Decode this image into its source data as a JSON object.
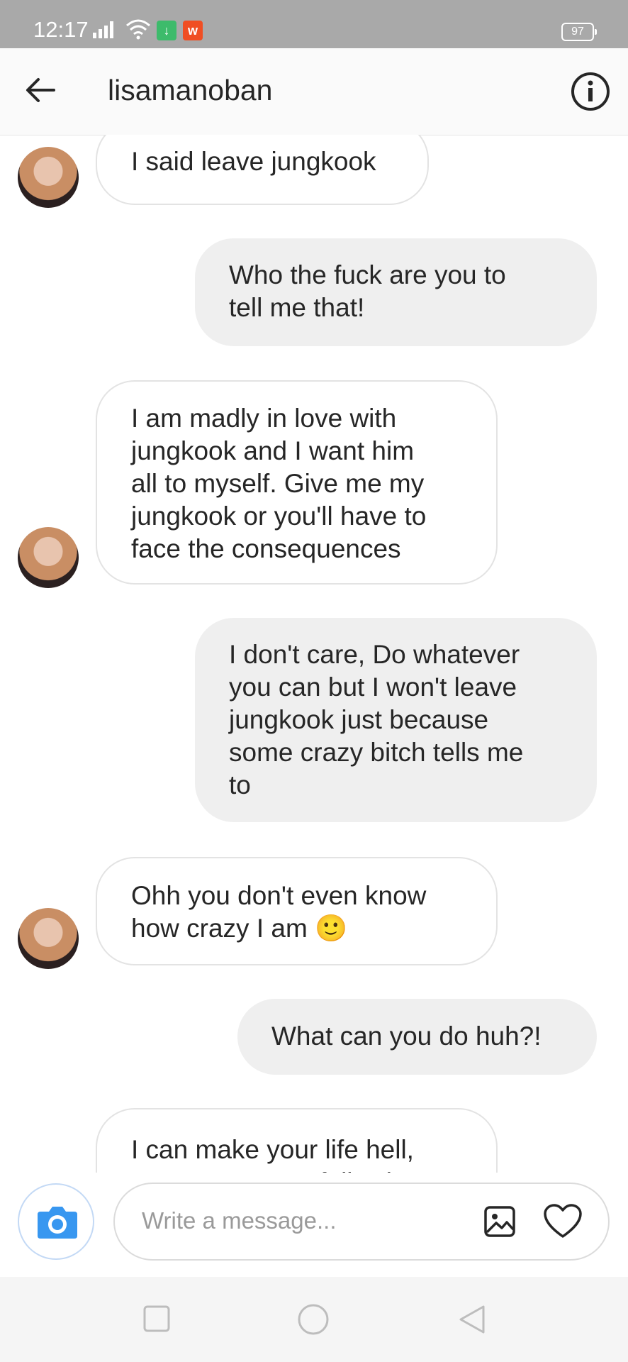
{
  "status_bar": {
    "time": "12:17",
    "battery": "97"
  },
  "header": {
    "username": "lisamanoban"
  },
  "messages": [
    {
      "side": "incoming",
      "text": "I said leave jungkook",
      "has_avatar": true
    },
    {
      "side": "outgoing",
      "text": "Who the fuck are you to\ntell me that!"
    },
    {
      "side": "incoming",
      "text": "I am madly in love with\njungkook and I want him\nall to myself. Give me my\njungkook or you'll have to\nface the consequences",
      "has_avatar": true
    },
    {
      "side": "outgoing",
      "text": "I don't care, Do whatever\nyou can but I won't leave\njungkook just because\nsome crazy bitch tells me\nto"
    },
    {
      "side": "incoming",
      "text": "Ohh you don't even know\nhow crazy I am 🙂",
      "has_avatar": true
    },
    {
      "side": "outgoing",
      "text": "What can you do huh?!"
    },
    {
      "side": "incoming",
      "text": "I can make your life hell,\nmy my men are following",
      "has_avatar": false
    }
  ],
  "composer": {
    "placeholder": "Write a message..."
  },
  "colors": {
    "status_bar": "#a9a9a9",
    "outgoing_bubble": "#efefef",
    "camera_blue": "#3897f0"
  }
}
